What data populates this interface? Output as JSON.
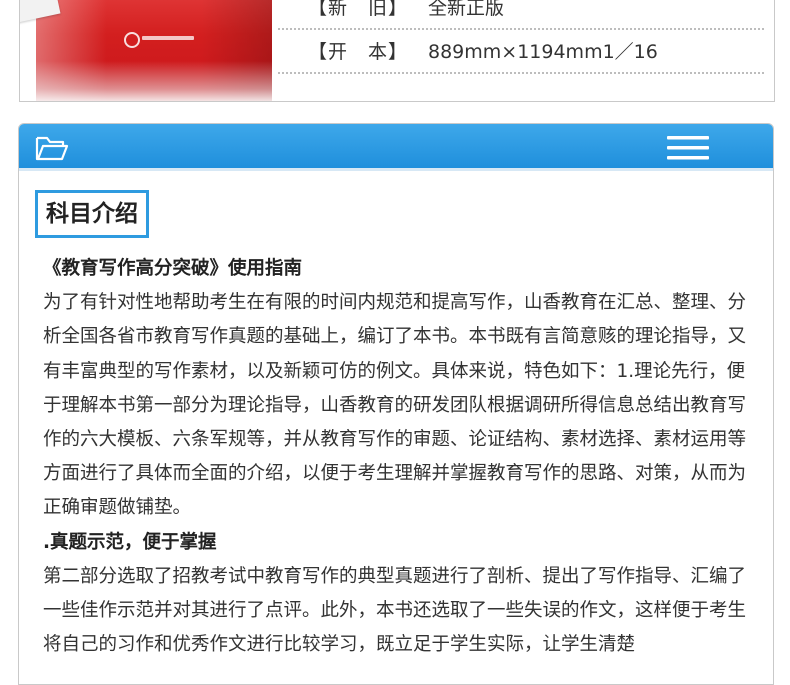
{
  "product_specs": [
    {
      "label": "【新　旧】",
      "value": "全新正版"
    },
    {
      "label": "【开　本】",
      "value": "889mm×1194mm1／16"
    }
  ],
  "section": {
    "title": "科目介绍",
    "icons": {
      "left": "folder-icon",
      "right": "menu-icon"
    },
    "header_color": "#2596e0"
  },
  "content": {
    "guide_title": "《教育写作高分突破》使用指南",
    "paragraph1": "为了有针对性地帮助考生在有限的时间内规范和提高写作，山香教育在汇总、整理、分析全国各省市教育写作真题的基础上，编订了本书。本书既有言简意赅的理论指导，又有丰富典型的写作素材，以及新颖可仿的例文。具体来说，特色如下：1.理论先行，便于理解本书第一部分为理论指导，山香教育的研发团队根据调研所得信息总结出教育写作的六大模板、六条军规等，并从教育写作的审题、论证结构、素材选择、素材运用等方面进行了具体而全面的介绍，以便于考生理解并掌握教育写作的思路、对策，从而为正确审题做铺垫。",
    "heading2": ".真题示范，便于掌握",
    "paragraph2": "第二部分选取了招教考试中教育写作的典型真题进行了剖析、提出了写作指导、汇编了一些佳作示范并对其进行了点评。此外，本书还选取了一些失误的作文，这样便于考生将自己的习作和优秀作文进行比较学习，既立足于学生实际，让学生清楚"
  }
}
